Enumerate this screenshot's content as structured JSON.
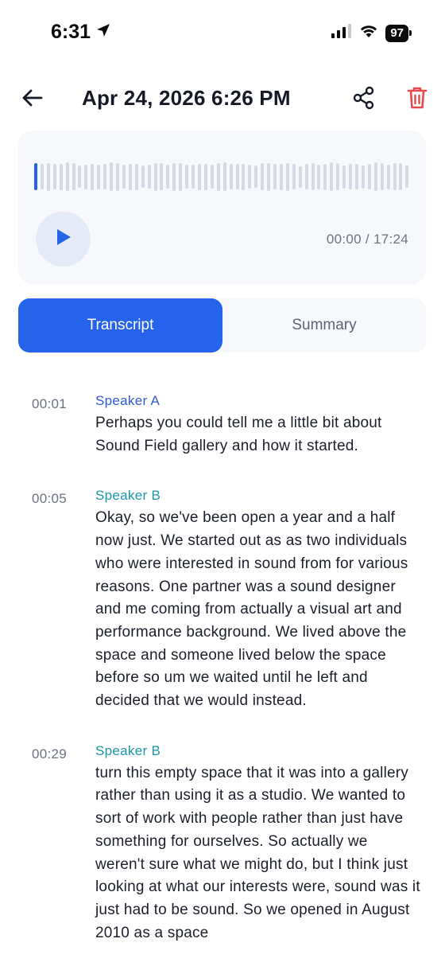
{
  "status_bar": {
    "time": "6:31",
    "battery": "97"
  },
  "header": {
    "title": "Apr 24, 2026 6:26 PM"
  },
  "player": {
    "current_time": "00:00",
    "total_time": "17:24",
    "time_separator": " / ",
    "progress": 0
  },
  "tabs": {
    "transcript": "Transcript",
    "summary": "Summary",
    "active": "transcript"
  },
  "transcript": [
    {
      "time": "00:01",
      "speaker": "Speaker A",
      "text": "Perhaps you could tell me a little bit about Sound Field gallery and how it started."
    },
    {
      "time": "00:05",
      "speaker": "Speaker B",
      "text": "Okay, so we've been open a year and a half now just. We started out as as two individuals who were interested in sound from for various reasons. One partner was a sound designer and me coming from actually a visual art and performance background. We lived above the space and someone lived below the space before so um we waited until he left and decided that we would instead."
    },
    {
      "time": "00:29",
      "speaker": "Speaker B",
      "text": "turn this empty space that it was into a gallery rather than using it as a studio. We wanted to sort of work with people rather than just have something for ourselves. So actually we weren't sure what we might do, but I think just looking at what our interests were, sound was it just had to be sound. So we opened in August 2010 as a space"
    }
  ],
  "colors": {
    "accent": "#2563eb",
    "speaker_a": "#2f5bd3",
    "speaker_b": "#1a97a8",
    "delete": "#e5484d"
  }
}
